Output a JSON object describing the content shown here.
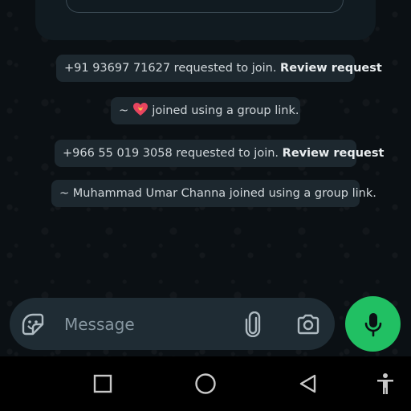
{
  "colors": {
    "chat_background": "#0b1014",
    "system_bubble": "#1d282f",
    "composer_background": "#1f2c34",
    "mic_button": "#21c063",
    "placeholder": "#8696a0",
    "nav_bar": "#000000"
  },
  "messages": [
    {
      "text": "+91 93697 71627 requested to join. ",
      "link": "Review request"
    },
    {
      "prefix": "~ ",
      "emoji": "heart-with-ribbon-emoji",
      "text": " joined using a group link."
    },
    {
      "text": "+966 55 019 3058 requested to join. ",
      "link": "Review request"
    },
    {
      "text": "~ Muhammad Umar Channa joined using a group link."
    }
  ],
  "composer": {
    "placeholder": "Message",
    "value": "",
    "icons": [
      "sticker-icon",
      "paperclip-icon",
      "camera-icon",
      "microphone-icon"
    ]
  },
  "navbar": {
    "icons": [
      "recents-square-icon",
      "home-circle-icon",
      "back-triangle-icon",
      "accessibility-icon"
    ]
  }
}
